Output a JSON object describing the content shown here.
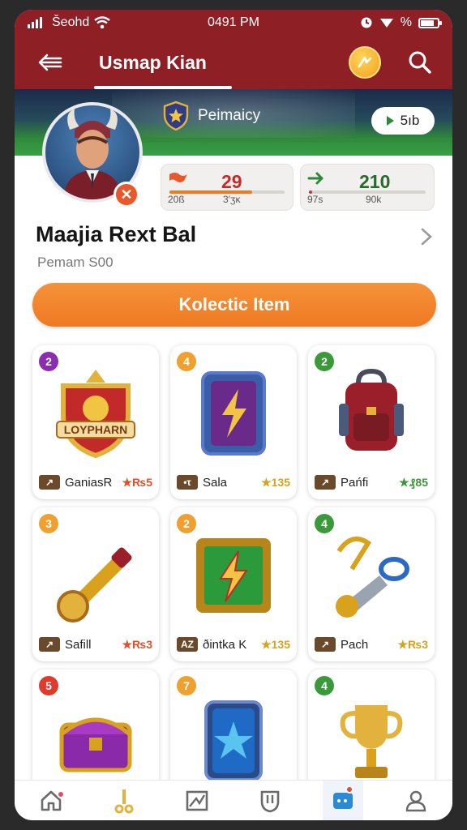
{
  "status": {
    "carrier": "Šeohd",
    "time": "0491 PM",
    "right_text": "%"
  },
  "appbar": {
    "title": "Usmap Kian",
    "back_icon": "back-arrow-icon",
    "coin_icon": "coin-icon",
    "search_icon": "search-icon"
  },
  "hero": {
    "league": "Peimaicy",
    "pill_label": "5ıb"
  },
  "profile": {
    "name": "Maajia Rext Bal",
    "subtitle": "Pemam S00",
    "stats": [
      {
        "value": "29",
        "label_left": "20ß",
        "label_right": "3′ʒκ",
        "progress": 0.72,
        "color": "#e8582a"
      },
      {
        "value": "210",
        "label_left": "97ѕ",
        "label_right": "90k",
        "progress": 0.03,
        "color": "#c23a3a"
      }
    ]
  },
  "cta": {
    "label": "Kolectic Item"
  },
  "items": [
    {
      "badge": "2",
      "badge_color": "#8a2db0",
      "icon_tag": "↗",
      "name": "GaniasR",
      "price": "★₨5",
      "price_color": "#e0502a",
      "art": "crest-shield-icon",
      "art_text": "LOYPHARN"
    },
    {
      "badge": "4",
      "badge_color": "#f0a030",
      "icon_tag": "•τ",
      "name": "Sala",
      "price": "★135",
      "price_color": "#d9a21c",
      "art": "lightning-card-icon"
    },
    {
      "badge": "2",
      "badge_color": "#3a9a3a",
      "icon_tag": "↗",
      "name": "Pańfi",
      "price": "★₰85",
      "price_color": "#3a9a3a",
      "art": "backpack-icon"
    },
    {
      "badge": "3",
      "badge_color": "#f0a030",
      "icon_tag": "↗",
      "name": "Safill",
      "price": "★₨3",
      "price_color": "#e0502a",
      "art": "horn-icon"
    },
    {
      "badge": "2",
      "badge_color": "#f0a030",
      "icon_tag": "AZ",
      "name": "ðintka K",
      "price": "★135",
      "price_color": "#d9a21c",
      "art": "green-lightning-box-icon"
    },
    {
      "badge": "4",
      "badge_color": "#3a9a3a",
      "icon_tag": "↗",
      "name": "Pach",
      "price": "★₨3",
      "price_color": "#d9a21c",
      "art": "whistle-icon"
    },
    {
      "badge": "5",
      "badge_color": "#e03a2a",
      "icon_tag": "",
      "name": "",
      "price": "",
      "price_color": "#222",
      "art": "treasure-chest-icon"
    },
    {
      "badge": "7",
      "badge_color": "#f0a030",
      "icon_tag": "",
      "name": "",
      "price": "",
      "price_color": "#222",
      "art": "star-card-icon"
    },
    {
      "badge": "4",
      "badge_color": "#3a9a3a",
      "icon_tag": "",
      "name": "",
      "price": "",
      "price_color": "#222",
      "art": "trophy-icon"
    }
  ],
  "nav": [
    {
      "icon": "home-icon"
    },
    {
      "icon": "key-icon"
    },
    {
      "icon": "card-icon"
    },
    {
      "icon": "shield-icon"
    },
    {
      "icon": "chat-icon",
      "active": true
    },
    {
      "icon": "profile-icon"
    }
  ],
  "colors": {
    "brand": "#8e1f25",
    "accent": "#ee7a22"
  }
}
